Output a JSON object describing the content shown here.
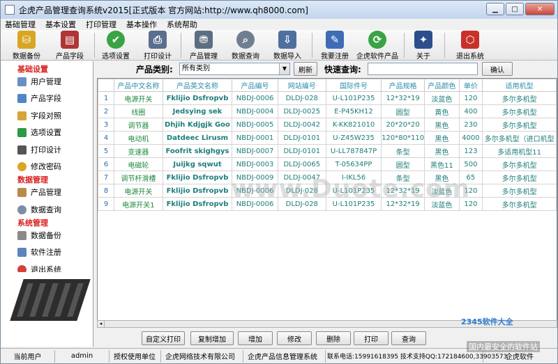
{
  "window": {
    "title": "企虎产品管理查询系统v2015[正式版本 官方网站:http://www.qh8000.com]"
  },
  "menu": [
    "基础管理",
    "基本设置",
    "打印管理",
    "基本操作",
    "系统帮助"
  ],
  "toolbar": [
    {
      "label": "数据备份",
      "icon": "database-backup-icon",
      "color": "#d9a623"
    },
    {
      "label": "产品字段",
      "icon": "product-fields-icon",
      "color": "#b03535"
    },
    {
      "label": "选项设置",
      "icon": "options-icon",
      "color": "#3aa345"
    },
    {
      "label": "打印设计",
      "icon": "printer-icon",
      "color": "#5a6f8e"
    },
    {
      "label": "产品管理",
      "icon": "product-manage-icon",
      "color": "#5c6e82"
    },
    {
      "label": "数据查询",
      "icon": "magnifier-icon",
      "color": "#6f7f8f"
    },
    {
      "label": "数据导入",
      "icon": "data-import-icon",
      "color": "#4f6f9e"
    },
    {
      "label": "我要注册",
      "icon": "register-icon",
      "color": "#3e6db5"
    },
    {
      "label": "企虎软件产品",
      "icon": "refresh-icon",
      "color": "#3aa345"
    },
    {
      "label": "关于",
      "icon": "about-icon",
      "color": "#2b4f8c"
    },
    {
      "label": "退出系统",
      "icon": "exit-icon",
      "color": "#c8302a"
    }
  ],
  "sidebar": {
    "sections": [
      {
        "title": "基础设置",
        "items": [
          "用户管理",
          "产品字段",
          "字段对照",
          "选项设置",
          "打印设计",
          "修改密码"
        ]
      },
      {
        "title": "数据管理",
        "items": [
          "产品管理",
          "数据查询"
        ]
      },
      {
        "title": "系统管理",
        "items": [
          "数据备份",
          "软件注册",
          "退出系统"
        ]
      }
    ]
  },
  "filter": {
    "category_label": "产品类别:",
    "category_value": "所有类别",
    "refresh_label": "刷新",
    "quick_label": "快速查询:",
    "quick_value": "",
    "confirm_label": "确认"
  },
  "table": {
    "columns": [
      "产品中文名称",
      "产品英文名称",
      "产品编号",
      "网站编号",
      "国际件号",
      "产品规格",
      "产品颜色",
      "单价",
      "适用机型"
    ],
    "rows": [
      [
        "电源开关",
        "Fklijio Dsfropvb",
        "NBDJ-0006",
        "DLDJ-028",
        "U-L101P235",
        "12*32*19",
        "淡蓝色",
        "120",
        "多尔多机型"
      ],
      [
        "线圈",
        "Jedsying sek",
        "NBDJ-0004",
        "DLDJ-0025",
        "E-P45KH12",
        "圆型",
        "黄色",
        "400",
        "多尔多机型"
      ],
      [
        "调节器",
        "Dhjih Kdjgjk Goo",
        "NBDJ-0005",
        "DLDJ-0042",
        "K-KK821010",
        "20*20*20",
        "黑色",
        "230",
        "多尔多机型"
      ],
      [
        "电动机",
        "Datdeec Lirusm",
        "NBDJ-0001",
        "DLDJ-0101",
        "U-Z45W235",
        "120*80*110",
        "黑色",
        "4000",
        "多尔多机型（进口机型"
      ],
      [
        "变速器",
        "Foofrit skighgys",
        "NBDJ-0007",
        "DLDJ-0101",
        "U-LL787847P",
        "条型",
        "黑色",
        "123",
        "多适用机型11"
      ],
      [
        "电磁轮",
        "Juijkg sqwut",
        "NBDJ-0003",
        "DLDJ-0065",
        "T-05634PP",
        "圆型",
        "黑色11",
        "500",
        "多尔多机型"
      ],
      [
        "调节杆滑槽",
        "Fklijio Dsfropvb",
        "NBDJ-0009",
        "DLDJ-0047",
        "I-IKL56",
        "条型",
        "黑色",
        "65",
        "多尔多机型"
      ],
      [
        "电源开关",
        "Fklijio Dsfropvb",
        "NBDJ-0006",
        "DLDJ-028",
        "U-L101P235",
        "12*32*19",
        "淡蓝色",
        "120",
        "多尔多机型"
      ],
      [
        "电源开关1",
        "Fklijio Dsfropvb",
        "NBDJ-0006",
        "DLDJ-028",
        "U-L101P235",
        "12*32*19",
        "淡蓝色",
        "120",
        "多尔多机型"
      ]
    ]
  },
  "actions": [
    "自定义打印",
    "复制增加",
    "增加",
    "修改",
    "删除",
    "打印",
    "查询"
  ],
  "status": {
    "user_label": "当前用户",
    "user_value": "admin",
    "unit_label": "授权使用单位",
    "unit_value": "企虎网络技术有限公司",
    "system_name": "企虎产品信息管理系统",
    "contact": "联系电话:15991618395 技术支持QQ:172184600,33903573",
    "vendor": "企虎软件"
  },
  "watermarks": {
    "center": "www.Duote.com",
    "brand": "2345软件大全",
    "brand_sub": "国内最安全的软件站"
  }
}
